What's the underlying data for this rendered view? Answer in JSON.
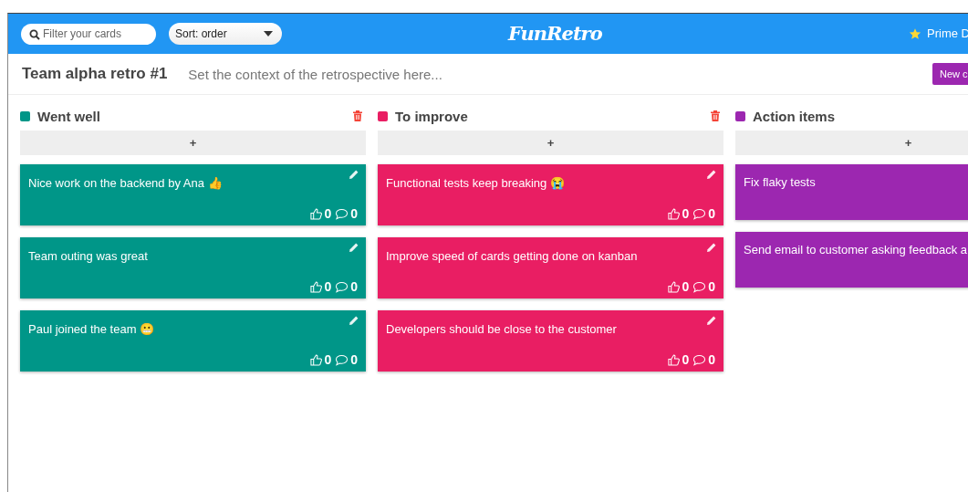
{
  "toolbar": {
    "filter": {
      "placeholder": "Filter your cards"
    },
    "sort": {
      "value": "Sort: order"
    },
    "logo": "FunRetro",
    "account": "Prime D"
  },
  "board": {
    "title": "Team alpha retro #1",
    "context": {
      "placeholder": "Set the context of the retrospective here..."
    },
    "new_button": "New c"
  },
  "columns": [
    {
      "title": "Went well",
      "color": "#009688",
      "delete_button": true,
      "add_label": "+",
      "cards": [
        {
          "text": "Nice work on the backend by Ana 👍",
          "editable": true,
          "likes": "0",
          "comments": "0"
        },
        {
          "text": "Team outing was great",
          "editable": true,
          "likes": "0",
          "comments": "0"
        },
        {
          "text": "Paul joined the team 😬",
          "editable": true,
          "likes": "0",
          "comments": "0"
        }
      ]
    },
    {
      "title": "To improve",
      "color": "#e91e63",
      "delete_button": true,
      "add_label": "+",
      "cards": [
        {
          "text": "Functional tests keep breaking 😭",
          "editable": true,
          "likes": "0",
          "comments": "0"
        },
        {
          "text": "Improve speed of cards getting done on kanban",
          "editable": true,
          "likes": "0",
          "comments": "0"
        },
        {
          "text": "Developers should be close to the customer",
          "editable": true,
          "likes": "0",
          "comments": "0"
        }
      ]
    },
    {
      "title": "Action items",
      "color": "#9c27b0",
      "delete_button": false,
      "add_label": "+",
      "cards": [
        {
          "text": "Fix flaky tests",
          "editable": false
        },
        {
          "text": "Send email to customer asking feedback a",
          "editable": false
        }
      ]
    }
  ]
}
